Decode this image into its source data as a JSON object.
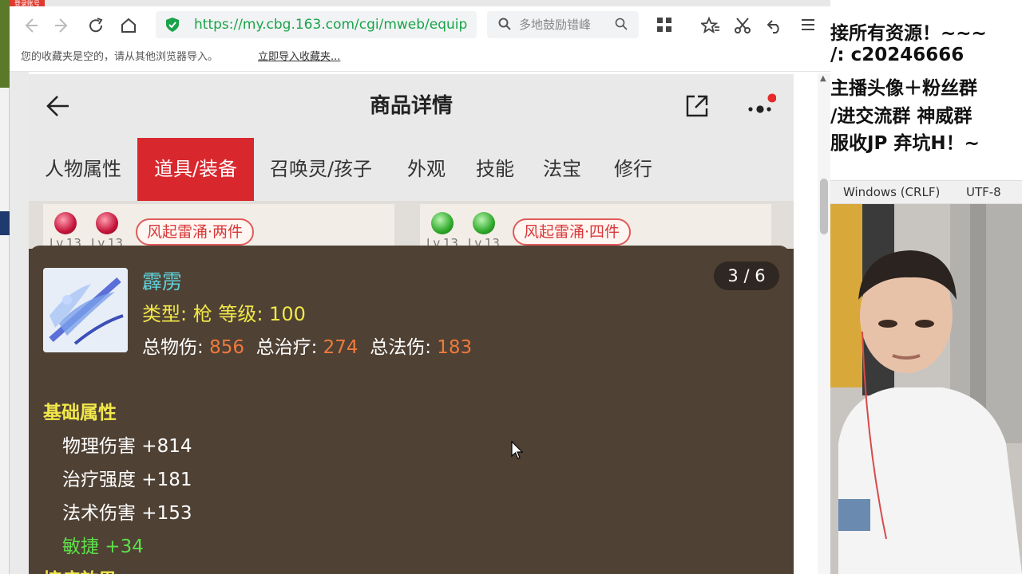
{
  "browser": {
    "login_badge": "登录账号",
    "url": "https://my.cbg.163.com/cgi/mweb/equip",
    "search_placeholder": "多地鼓励错峰",
    "bookmark_message": "您的收藏夹是空的，请从其他浏览器导入。",
    "bookmark_import_link": "立即导入收藏夹...",
    "accent_color": "#1aa34a"
  },
  "app": {
    "title": "商品详情",
    "tabs": [
      {
        "label": "人物属性",
        "active": false
      },
      {
        "label": "道具/装备",
        "active": true
      },
      {
        "label": "召唤灵/孩子",
        "active": false
      },
      {
        "label": "外观",
        "active": false
      },
      {
        "label": "技能",
        "active": false
      },
      {
        "label": "法宝",
        "active": false
      },
      {
        "label": "修行",
        "active": false
      }
    ],
    "equip_left": {
      "gem_level_1": "Lv.13",
      "gem_level_2": "Lv.13",
      "set": "风起雷涌·两件"
    },
    "equip_right": {
      "gem_level_1": "Lv.13",
      "gem_level_2": "Lv.13",
      "set": "风起雷涌·四件"
    },
    "tab_active_color": "#d9272e"
  },
  "item": {
    "name": "霹雳",
    "type_line": "类型: 枪   等级: 100",
    "stats": [
      {
        "label": "总物伤:",
        "value": "856"
      },
      {
        "label": "总治疗:",
        "value": "274"
      },
      {
        "label": "总法伤:",
        "value": "183"
      }
    ],
    "page": "3 / 6",
    "base_section": "基础属性",
    "attributes": [
      {
        "text": "物理伤害 +814",
        "highlight": false
      },
      {
        "text": "治疗强度 +181",
        "highlight": false
      },
      {
        "text": "法术伤害 +153",
        "highlight": false
      },
      {
        "text": "敏捷 +34",
        "highlight": true
      }
    ],
    "next_section": "控疗效果"
  },
  "stream_overlay": {
    "lines": [
      "接所有资源！~~~",
      "/: c20246666",
      "主播头像＋粉丝群",
      "/进交流群 神威群",
      "服收JP   弃坑H！~"
    ],
    "status_eol": "Windows (CRLF)",
    "status_encoding": "UTF-8"
  }
}
